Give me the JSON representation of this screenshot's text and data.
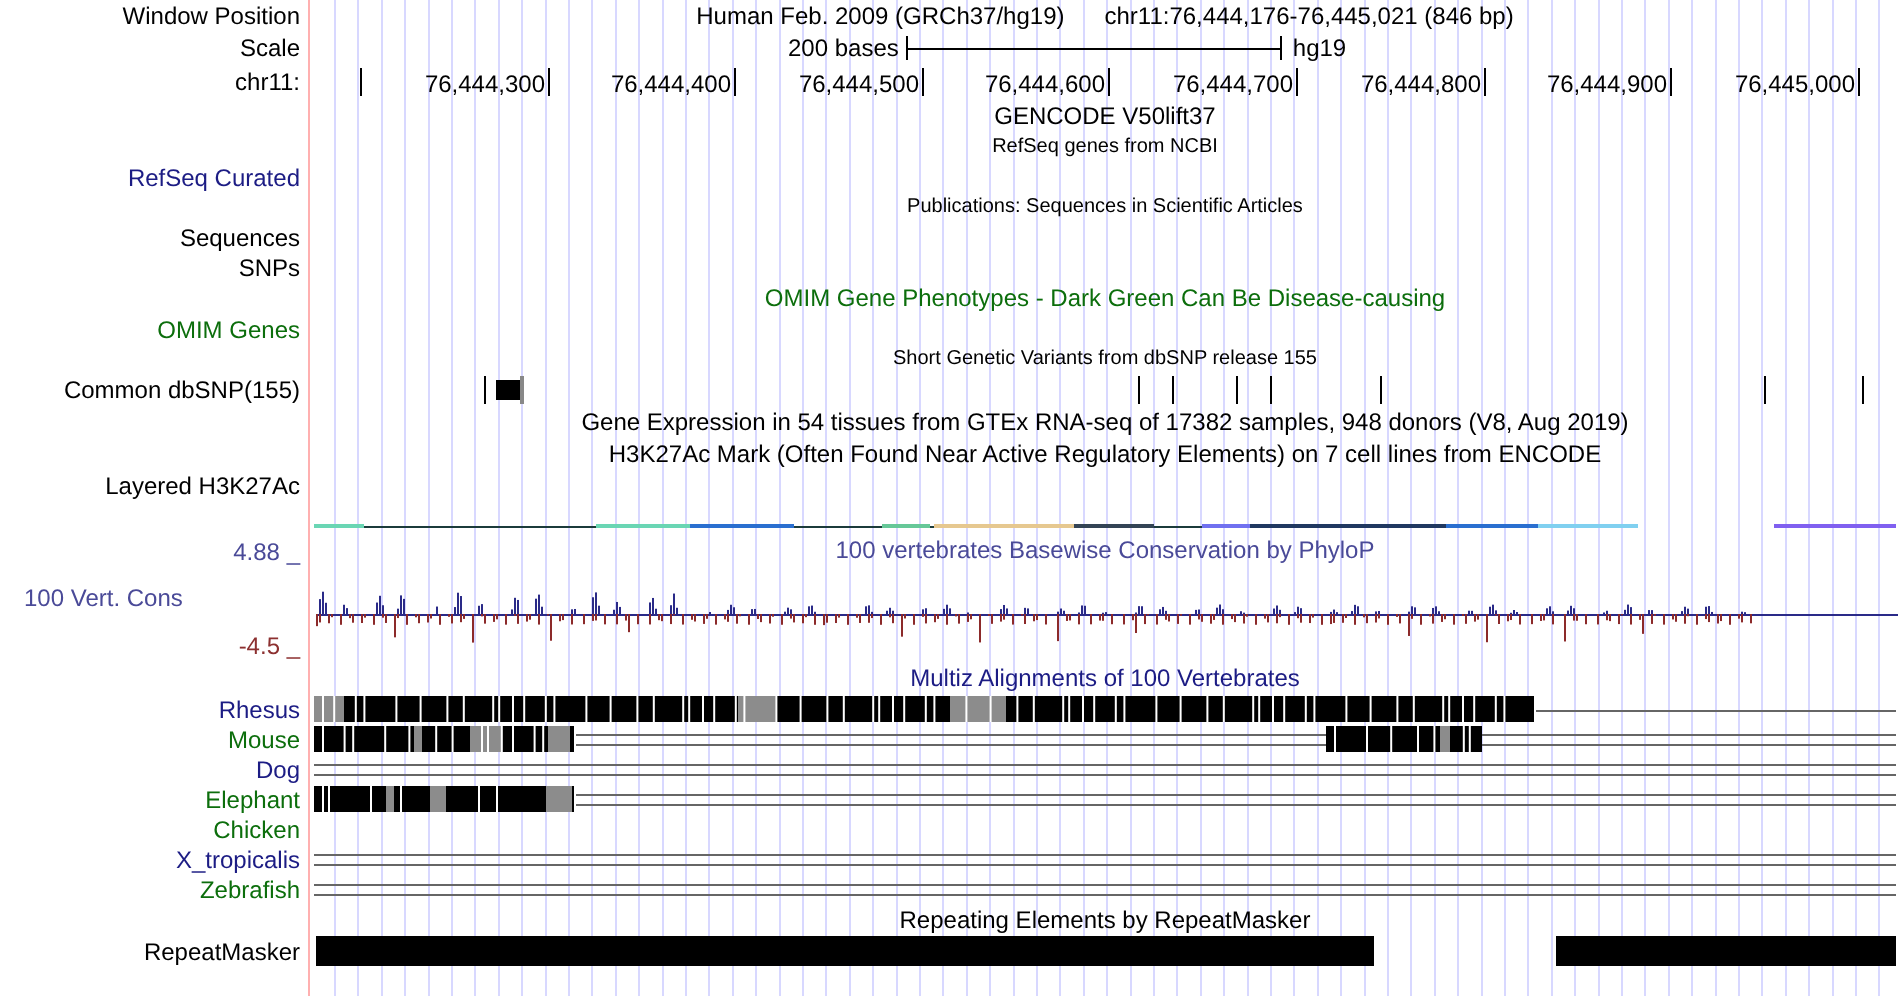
{
  "header": {
    "label": "Window Position",
    "assembly": "Human Feb. 2009 (GRCh37/hg19)",
    "position": "chr11:76,444,176-76,445,021 (846 bp)"
  },
  "scale": {
    "label": "Scale",
    "length": "200 bases",
    "assembly": "hg19"
  },
  "ruler": {
    "label": "chr11:",
    "ticks": [
      "76,444,300",
      "76,444,400",
      "76,444,500",
      "76,444,600",
      "76,444,700",
      "76,444,800",
      "76,444,900",
      "76,445,000"
    ]
  },
  "rows": [
    {
      "kind": "title",
      "title": "GENCODE V50lift37"
    },
    {
      "kind": "caption",
      "title": "RefSeq genes from NCBI"
    },
    {
      "kind": "label",
      "label": "RefSeq Curated",
      "color": "#1c1c84"
    },
    {
      "kind": "caption",
      "title": "Publications: Sequences in Scientific Articles"
    },
    {
      "kind": "label",
      "label": "Sequences"
    },
    {
      "kind": "label",
      "label": "SNPs"
    },
    {
      "kind": "title",
      "title": "OMIM Gene Phenotypes - Dark Green Can Be Disease-causing",
      "color": "#0c6e0c"
    },
    {
      "kind": "label",
      "label": "OMIM Genes",
      "color": "#0c6e0c"
    },
    {
      "kind": "caption",
      "title": "Short Genetic Variants from dbSNP release 155"
    },
    {
      "kind": "snps",
      "label": "Common dbSNP(155)"
    },
    {
      "kind": "title",
      "title": "Gene Expression in 54 tissues from GTEx RNA-seq of 17382 samples, 948 donors (V8, Aug 2019)"
    },
    {
      "kind": "title",
      "title": "H3K27Ac Mark (Often Found Near Active Regulatory Elements) on 7 cell lines from ENCODE"
    },
    {
      "kind": "label",
      "label": "Layered H3K27Ac"
    },
    {
      "kind": "layered"
    },
    {
      "kind": "phylop",
      "top_label": "4.88 _",
      "title": "100 vertebrates Basewise Conservation by PhyloP",
      "label": "100 Vert. Cons",
      "bottom_label": "-4.5 _",
      "color": "#4a4a98"
    },
    {
      "kind": "title",
      "title": "Multiz Alignments of 100 Vertebrates",
      "color": "#1c1c84"
    },
    {
      "kind": "species",
      "species": [
        {
          "label": "Rhesus",
          "color": "#1c1c84",
          "kind": "long"
        },
        {
          "label": "Mouse",
          "color": "#0c6e0c",
          "kind": "split"
        },
        {
          "label": "Dog",
          "color": "#1c1c84",
          "kind": "lines"
        },
        {
          "label": "Elephant",
          "color": "#0c6e0c",
          "kind": "short"
        },
        {
          "label": "Chicken",
          "color": "#0c6e0c",
          "kind": "none"
        },
        {
          "label": "X_tropicalis",
          "color": "#1c1c84",
          "kind": "lines"
        },
        {
          "label": "Zebrafish",
          "color": "#0c6e0c",
          "kind": "lines"
        }
      ]
    },
    {
      "kind": "title",
      "title": "Repeating Elements by RepeatMasker"
    },
    {
      "kind": "repeats",
      "label": "RepeatMasker"
    }
  ]
}
